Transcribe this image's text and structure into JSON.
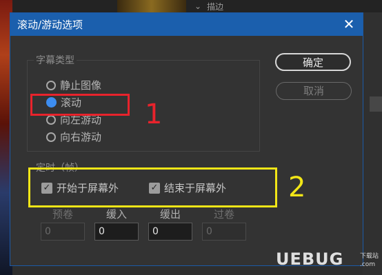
{
  "background": {
    "panel_title": "描边",
    "accent_red": "#e8232c",
    "accent_yellow": "#f2e617"
  },
  "dialog": {
    "title": "滚动/游动选项",
    "close_icon": "close-icon",
    "ok_label": "确定",
    "cancel_label": "取消",
    "subtitle_type": {
      "legend": "字幕类型",
      "options": [
        "静止图像",
        "滚动",
        "向左游动",
        "向右游动"
      ],
      "selected": "滚动"
    },
    "timing": {
      "legend": "定时（帧）",
      "start_offscreen_label": "开始于屏幕外",
      "start_offscreen_checked": true,
      "end_offscreen_label": "结束于屏幕外",
      "end_offscreen_checked": true,
      "fields": [
        {
          "label": "预卷",
          "value": "0",
          "enabled": false
        },
        {
          "label": "缓入",
          "value": "0",
          "enabled": true
        },
        {
          "label": "缓出",
          "value": "0",
          "enabled": true
        },
        {
          "label": "过卷",
          "value": "0",
          "enabled": false
        }
      ]
    }
  },
  "annotations": {
    "marker_1": "1",
    "marker_2": "2"
  },
  "watermark": {
    "brand": "UEBUG",
    "sub": "下载站",
    "domain": ".com"
  }
}
